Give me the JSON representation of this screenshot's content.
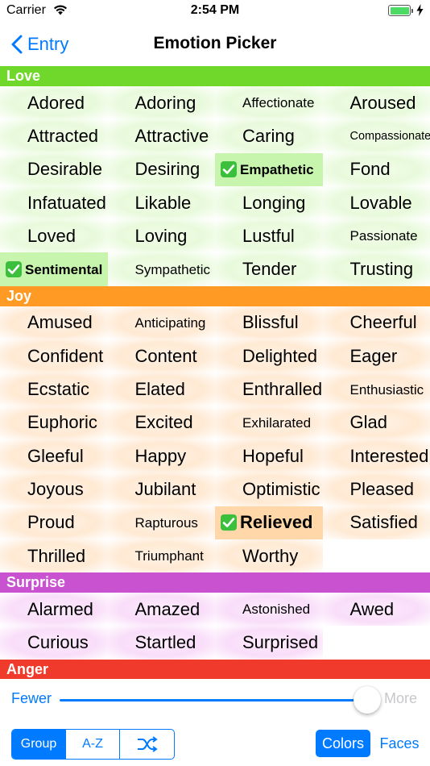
{
  "status_bar": {
    "carrier": "Carrier",
    "time": "2:54 PM",
    "wifi_icon": "wifi-icon",
    "battery_icon": "battery-icon",
    "charging_icon": "bolt-icon"
  },
  "nav": {
    "back_label": "Entry",
    "back_icon": "chevron-left-icon",
    "title": "Emotion Picker"
  },
  "colors": {
    "accent": "#007aff",
    "love": "#6fd82a",
    "joy": "#ff9a24",
    "surprise": "#c852cf",
    "anger": "#f03a2c",
    "check": "#3cbf3c"
  },
  "sections": [
    {
      "name": "Love",
      "key": "love",
      "items": [
        {
          "word": "Adored"
        },
        {
          "word": "Adoring"
        },
        {
          "word": "Affectionate",
          "size": "small"
        },
        {
          "word": "Aroused"
        },
        {
          "word": "Attracted"
        },
        {
          "word": "Attractive"
        },
        {
          "word": "Caring"
        },
        {
          "word": "Compassionate",
          "size": "tiny"
        },
        {
          "word": "Desirable"
        },
        {
          "word": "Desiring"
        },
        {
          "word": "Empathetic",
          "size": "small",
          "selected": true
        },
        {
          "word": "Fond"
        },
        {
          "word": "Infatuated"
        },
        {
          "word": "Likable"
        },
        {
          "word": "Longing"
        },
        {
          "word": "Lovable"
        },
        {
          "word": "Loved"
        },
        {
          "word": "Loving"
        },
        {
          "word": "Lustful"
        },
        {
          "word": "Passionate",
          "size": "small"
        },
        {
          "word": "Sentimental",
          "size": "small",
          "selected": true
        },
        {
          "word": "Sympathetic",
          "size": "small"
        },
        {
          "word": "Tender"
        },
        {
          "word": "Trusting"
        }
      ]
    },
    {
      "name": "Joy",
      "key": "joy",
      "items": [
        {
          "word": "Amused"
        },
        {
          "word": "Anticipating",
          "size": "small"
        },
        {
          "word": "Blissful"
        },
        {
          "word": "Cheerful"
        },
        {
          "word": "Confident"
        },
        {
          "word": "Content"
        },
        {
          "word": "Delighted"
        },
        {
          "word": "Eager"
        },
        {
          "word": "Ecstatic"
        },
        {
          "word": "Elated"
        },
        {
          "word": "Enthralled"
        },
        {
          "word": "Enthusiastic",
          "size": "small"
        },
        {
          "word": "Euphoric"
        },
        {
          "word": "Excited"
        },
        {
          "word": "Exhilarated",
          "size": "small"
        },
        {
          "word": "Glad"
        },
        {
          "word": "Gleeful"
        },
        {
          "word": "Happy"
        },
        {
          "word": "Hopeful"
        },
        {
          "word": "Interested"
        },
        {
          "word": "Joyous"
        },
        {
          "word": "Jubilant"
        },
        {
          "word": "Optimistic"
        },
        {
          "word": "Pleased"
        },
        {
          "word": "Proud"
        },
        {
          "word": "Rapturous",
          "size": "small"
        },
        {
          "word": "Relieved",
          "selected": true
        },
        {
          "word": "Satisfied"
        },
        {
          "word": "Thrilled"
        },
        {
          "word": "Triumphant",
          "size": "small"
        },
        {
          "word": "Worthy"
        }
      ]
    },
    {
      "name": "Surprise",
      "key": "surprise",
      "items": [
        {
          "word": "Alarmed"
        },
        {
          "word": "Amazed"
        },
        {
          "word": "Astonished",
          "size": "small"
        },
        {
          "word": "Awed"
        },
        {
          "word": "Curious"
        },
        {
          "word": "Startled"
        },
        {
          "word": "Surprised"
        }
      ]
    },
    {
      "name": "Anger",
      "key": "anger",
      "items": []
    }
  ],
  "slider": {
    "min_label": "Fewer",
    "max_label": "More",
    "value_fraction": 0.96
  },
  "toolbar": {
    "segments": [
      {
        "label": "Group",
        "active": true
      },
      {
        "label": "A-Z",
        "active": false
      },
      {
        "label": "",
        "icon": "shuffle-icon",
        "active": false
      }
    ],
    "colors_label": "Colors",
    "faces_label": "Faces"
  }
}
